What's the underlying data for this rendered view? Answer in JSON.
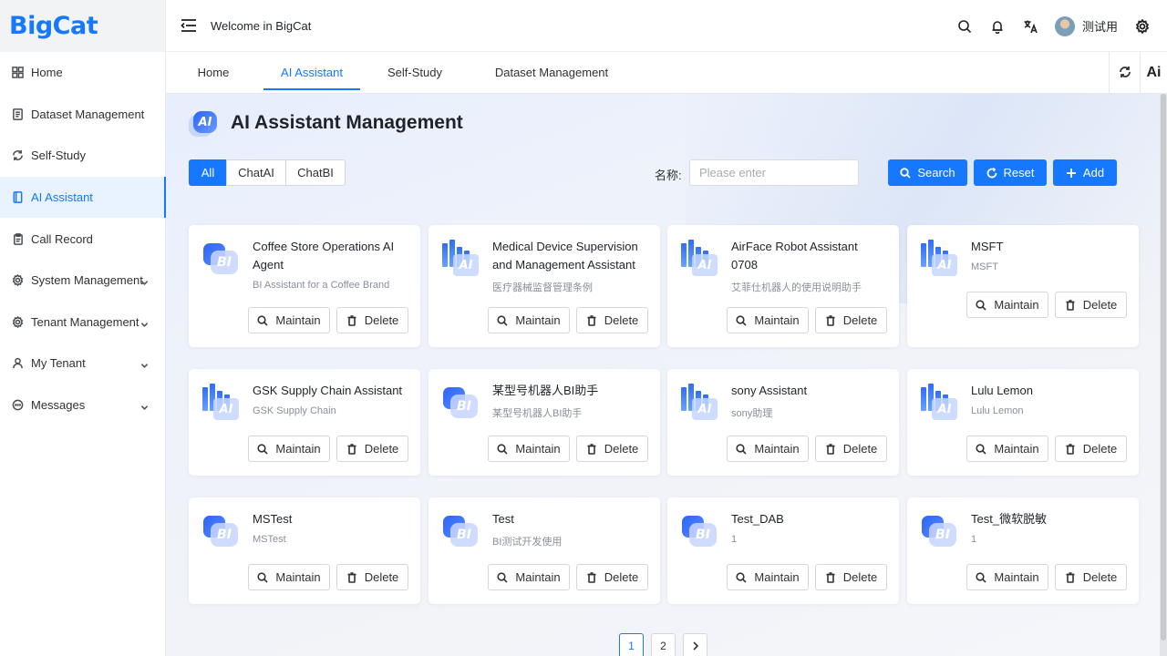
{
  "app": {
    "logo": "BigCat",
    "welcome": "Welcome in BigCat",
    "username": "测试用"
  },
  "sidebar": {
    "items": [
      {
        "label": "Home",
        "icon": "grid-icon",
        "active": false,
        "chevron": false
      },
      {
        "label": "Dataset Management",
        "icon": "document-icon",
        "active": false,
        "chevron": false
      },
      {
        "label": "Self-Study",
        "icon": "refresh-icon",
        "active": false,
        "chevron": false
      },
      {
        "label": "AI Assistant",
        "icon": "book-icon",
        "active": true,
        "chevron": false
      },
      {
        "label": "Call Record",
        "icon": "clipboard-icon",
        "active": false,
        "chevron": false
      },
      {
        "label": "System Management",
        "icon": "gear-icon",
        "active": false,
        "chevron": true
      },
      {
        "label": "Tenant Management",
        "icon": "gear-icon",
        "active": false,
        "chevron": true
      },
      {
        "label": "My Tenant",
        "icon": "user-icon",
        "active": false,
        "chevron": true
      },
      {
        "label": "Messages",
        "icon": "chat-icon",
        "active": false,
        "chevron": true
      }
    ]
  },
  "header": {
    "icons": [
      "search-icon",
      "bell-icon",
      "translate-icon",
      "avatar",
      "gear-icon"
    ]
  },
  "tabs": [
    {
      "label": "Home",
      "active": false
    },
    {
      "label": "AI Assistant",
      "active": true
    },
    {
      "label": "Self-Study",
      "active": false
    },
    {
      "label": "Dataset Management",
      "active": false
    }
  ],
  "tab_tools": {
    "refresh_icon": "refresh-icon",
    "ai_label": "Ai"
  },
  "page": {
    "title": "AI Assistant Management",
    "filters": [
      {
        "label": "All",
        "active": true
      },
      {
        "label": "ChatAI",
        "active": false
      },
      {
        "label": "ChatBI",
        "active": false
      }
    ],
    "name_label": "名称:",
    "name_placeholder": "Please enter",
    "search_label": "Search",
    "reset_label": "Reset",
    "add_label": "Add"
  },
  "cards": [
    {
      "title": "Coffee Store Operations AI Agent",
      "desc": "BI Assistant for a Coffee Brand",
      "type": "BI"
    },
    {
      "title": "Medical Device Supervision and Management Assistant",
      "desc": "医疗器械监督管理条例",
      "type": "AI"
    },
    {
      "title": "AirFace Robot Assistant 0708",
      "desc": "艾菲仕机器人的使用说明助手",
      "type": "AI"
    },
    {
      "title": "MSFT",
      "desc": "MSFT",
      "type": "AI"
    },
    {
      "title": "GSK Supply Chain Assistant",
      "desc": "GSK Supply Chain",
      "type": "AI"
    },
    {
      "title": "某型号机器人BI助手",
      "desc": "某型号机器人BI助手",
      "type": "BI"
    },
    {
      "title": "sony Assistant",
      "desc": "sony助理",
      "type": "AI"
    },
    {
      "title": "Lulu Lemon",
      "desc": "Lulu Lemon",
      "type": "AI"
    },
    {
      "title": "MSTest",
      "desc": "MSTest",
      "type": "BI"
    },
    {
      "title": "Test",
      "desc": "BI测试开发使用",
      "type": "BI"
    },
    {
      "title": "Test_DAB",
      "desc": "1",
      "type": "BI"
    },
    {
      "title": "Test_微软脱敏",
      "desc": "1",
      "type": "BI"
    }
  ],
  "card_actions": {
    "maintain": "Maintain",
    "delete": "Delete"
  },
  "pagination": {
    "pages": [
      "1",
      "2"
    ],
    "current": "1"
  },
  "colors": {
    "primary": "#1677ff"
  }
}
